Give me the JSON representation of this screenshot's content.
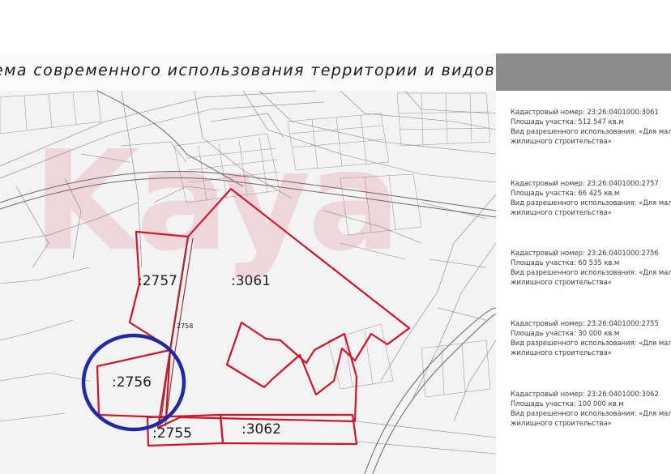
{
  "map_title": "ема современного использования территории и видов разрешенного использован",
  "parcels": [
    {
      "label": ":3061"
    },
    {
      "label": ":2757"
    },
    {
      "label": ":2756"
    },
    {
      "label": ":2755"
    },
    {
      "label": ":3062"
    },
    {
      "label": "2758"
    }
  ],
  "legend": [
    {
      "cadastral": "Кадастровый номер: 23:26:0401000:3061",
      "area": "Площадь участка: 512 547 кв.м",
      "use_1": "Вид разрешенного использования: «Для мал",
      "use_2": "жилищного строительства»"
    },
    {
      "cadastral": "Кадастровый номер: 23:26:0401000:2757",
      "area": "Площадь участка: 66 425 кв.м",
      "use_1": "Вид разрешенного использования: «Для мал",
      "use_2": "жилищного строительства»"
    },
    {
      "cadastral": "Кадастровый номер: 23:26:0401000:2756",
      "area": "Площадь участка: 60 535 кв.м",
      "use_1": "Вид разрешенного использования: «Для мал",
      "use_2": "жилищного строительства»"
    },
    {
      "cadastral": "Кадастровый номер: 23:26:0401000:2755",
      "area": "Площадь участка: 30 000 кв.м",
      "use_1": "Вид разрешенного использования: «Для мал",
      "use_2": "жилищного строительства»"
    },
    {
      "cadastral": "Кадастровый номер: 23:26:0401000:3062",
      "area": "Площадь участка: 100 000 кв.м",
      "use_1": "Вид разрешенного использования: «Для мал",
      "use_2": "жилищного строительства»"
    }
  ],
  "watermark": "Kaya",
  "colors": {
    "parcel_border": "#d01428",
    "highlight_circle": "#1e2aa8",
    "legend_header": "#8c8c8c"
  }
}
